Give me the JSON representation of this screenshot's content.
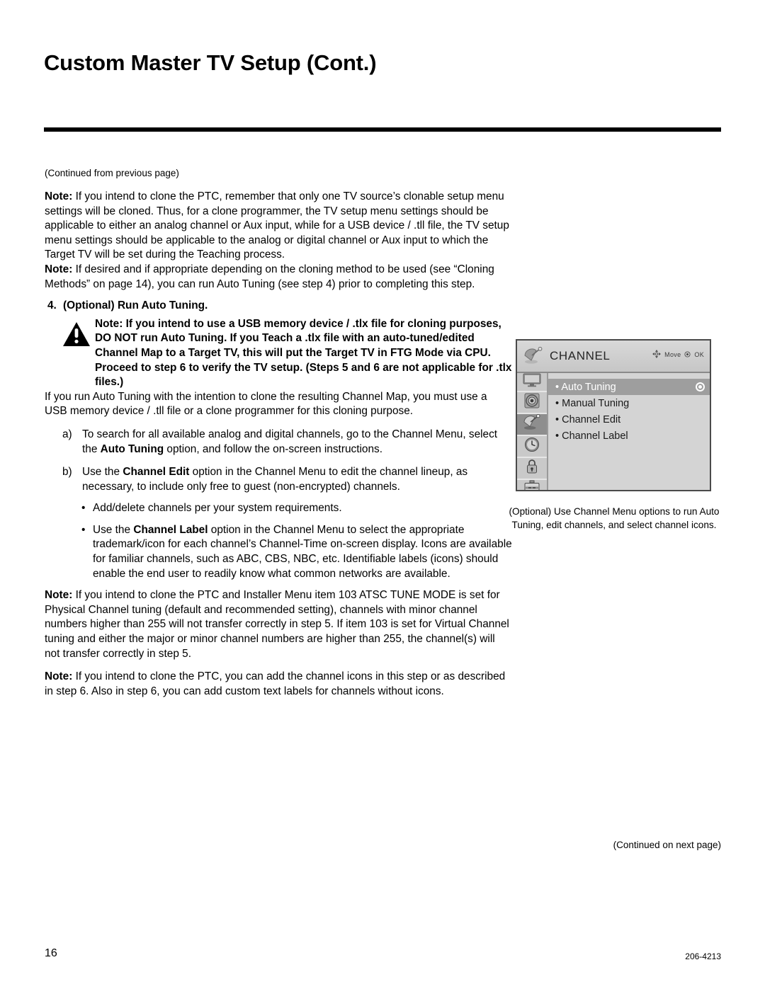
{
  "header": {
    "title": "Custom Master TV Setup (Cont.)"
  },
  "body": {
    "continued_from": "(Continued from previous page)",
    "note1_label": "Note:",
    "note1_text": " If you intend to clone the PTC, remember that only one TV source’s clonable setup menu settings will be cloned. Thus, for a clone programmer, the TV setup menu settings should be applicable to either an analog channel or Aux input, while for a USB device / .tll file, the TV setup menu settings should be applicable to the analog or digital channel or Aux input to which the Target TV will be set during the Teaching process.",
    "note2_label": "Note:",
    "note2_text": " If desired and if appropriate depending on the cloning method to be used (see “Cloning Methods” on page 14), you can run Auto Tuning (see step 4) prior to completing this step.",
    "step4_number": "4.",
    "step4_title": "(Optional) Run Auto Tuning.",
    "warning_text": "Note: If you intend to use a USB memory device / .tlx file for cloning purposes, DO NOT run Auto Tuning. If you Teach a .tlx file with an auto-tuned/edited Channel Map to a Target TV, this will put the Target TV in FTG Mode via CPU. Proceed to step 6 to verify the TV setup. (Steps 5 and 6 are not applicable for .tlx files.)",
    "para_autotune": "If you run Auto Tuning with the intention to clone the resulting Channel Map, you must use a USB memory device / .tll file or a clone programmer for this cloning purpose.",
    "item_a_mark": "a)",
    "item_a_t1": "To search for all available analog and digital channels, go to the Channel Menu, select the ",
    "item_a_bold": "Auto Tuning",
    "item_a_t2": " option, and follow the on-screen instructions.",
    "item_b_mark": "b)",
    "item_b_t1": "Use the ",
    "item_b_bold": "Channel Edit",
    "item_b_t2": " option in the Channel Menu to edit the channel lineup, as necessary, to include only free to guest (non-encrypted) channels.",
    "bullet_dot": "•",
    "bullet1": "Add/delete channels per your system requirements.",
    "bullet2_t1": "Use the ",
    "bullet2_bold": "Channel Label",
    "bullet2_t2": " option in the Channel Menu to select the appropriate trademark/icon for each channel’s Channel-Time on-screen display. Icons are available for familiar channels, such as ABC, CBS, NBC, etc. Identifiable labels (icons) should enable the end user to readily know what common networks are available.",
    "note3_label": "Note:",
    "note3_text": " If you intend to clone the PTC and Installer Menu item 103 ATSC TUNE MODE is set for Physical Channel tuning (default and recommended setting), channels with minor channel numbers higher than 255 will not transfer correctly in step 5. If item 103 is set for Virtual Channel tuning and either the major or minor channel numbers are higher than 255, the channel(s) will not transfer correctly in step 5.",
    "note4_label": "Note:",
    "note4_text": " If you intend to clone the PTC, you can add the channel icons in this step or as described in step 6. Also in step 6, you can add custom text labels for channels without icons."
  },
  "osd": {
    "title": "CHANNEL",
    "hint_move": "Move",
    "hint_ok": "OK",
    "items": [
      {
        "label": "Auto Tuning",
        "selected": true
      },
      {
        "label": "Manual Tuning",
        "selected": false
      },
      {
        "label": "Channel Edit",
        "selected": false
      },
      {
        "label": "Channel Label",
        "selected": false
      }
    ],
    "bullet": "•",
    "caption": "(Optional) Use Channel Menu options to run Auto Tuning, edit channels, and select channel icons."
  },
  "footer": {
    "continued_next": "(Continued on next page)",
    "page_number": "16",
    "doc_code": "206-4213"
  },
  "colors": {
    "rule": "#000000",
    "osd_panel": "#d4d4d4",
    "osd_selected": "#9e9e9e"
  }
}
